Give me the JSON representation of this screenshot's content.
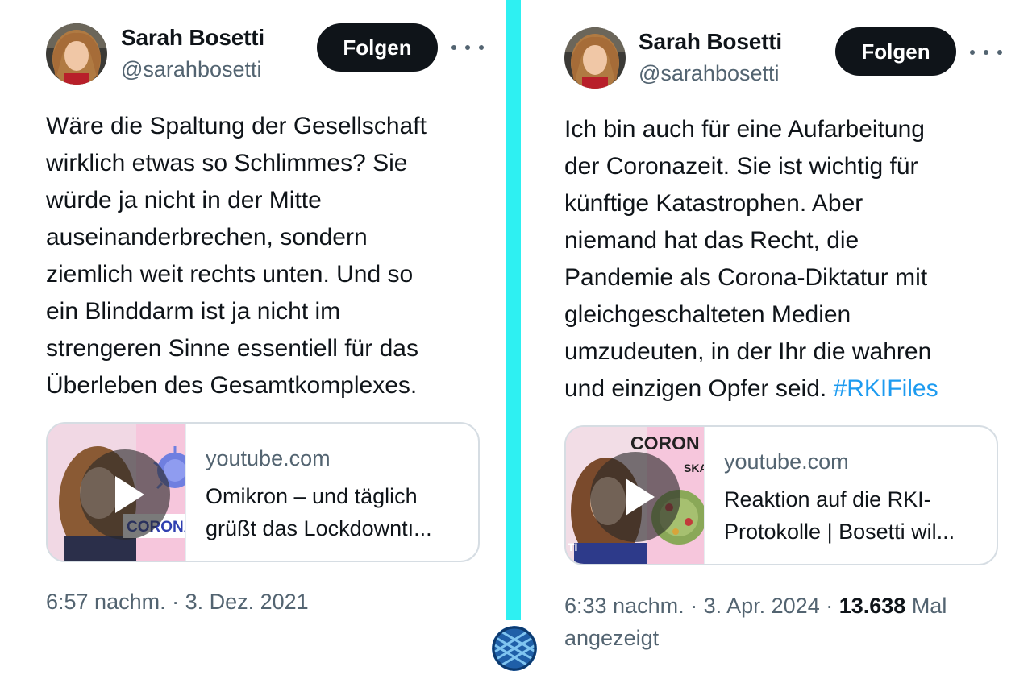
{
  "tweets": [
    {
      "author": {
        "name": "Sarah Bosetti",
        "handle": "@sarahbosetti"
      },
      "follow_label": "Folgen",
      "text_lines": [
        "Wäre die Spaltung der Gesellschaft",
        "wirklich etwas so Schlimmes? Sie",
        "würde ja nicht in der Mitte",
        "auseinanderbrechen, sondern",
        "ziemlich weit rechts unten. Und so",
        "ein Blinddarm ist ja nicht im",
        "strengeren Sinne essentiell für das",
        "Überleben des Gesamtkomplexes."
      ],
      "card": {
        "domain": "youtube.com",
        "title_lines": [
          "Omikron – und täglich",
          "grüßt das Lockdowntı..."
        ],
        "thumb_text": "CORONA"
      },
      "meta": "6:57 nachm. · 3. Dez. 2021"
    },
    {
      "author": {
        "name": "Sarah Bosetti",
        "handle": "@sarahbosetti"
      },
      "follow_label": "Folgen",
      "text_lines": [
        "Ich bin auch für eine Aufarbeitung",
        "der Coronazeit. Sie ist wichtig für",
        "künftige Katastrophen. Aber",
        "niemand hat das Recht, die",
        "Pandemie als Corona-Diktatur mit",
        "gleichgeschalteten Medien",
        "umzudeuten, in der Ihr die wahren"
      ],
      "last_line": "und einzigen Opfer seid. ",
      "hashtag": "#RKIFiles",
      "card": {
        "domain": "youtube.com",
        "title_lines": [
          "Reaktion auf die RKI-",
          "Protokolle | Bosetti wil..."
        ],
        "thumb_text": "CORON",
        "thumb_text_2": "SKA",
        "thumb_text_3": "TI"
      },
      "meta": "6:33 nachm. · 3. Apr. 2024 · ",
      "views_count": "13.638",
      "views_suffix_1": " Mal",
      "views_suffix_2": "angezeigt"
    }
  ],
  "colors": {
    "divider": "#2ef0f2",
    "text": "#0f1419",
    "secondary": "#536471",
    "link": "#1d9bf0",
    "button": "#0f1419"
  }
}
